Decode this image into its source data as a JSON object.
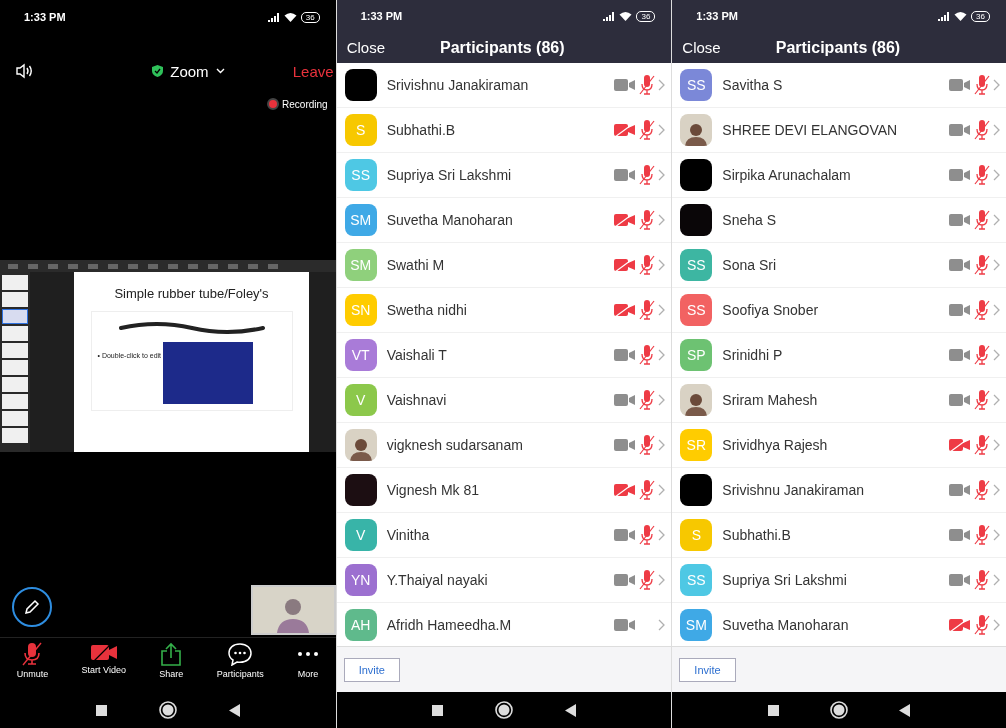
{
  "screens": [
    {
      "kind": "meeting",
      "status": {
        "time": "1:33 PM",
        "battery": "36"
      },
      "meeting_title": "Zoom",
      "leave": "Leave",
      "recording": "Recording",
      "slide": {
        "title": "Simple rubber tube/Foley's",
        "bullet": "• Double-click to edit",
        "thumbnails": [
          {
            "selected": false
          },
          {
            "selected": false
          },
          {
            "selected": true
          },
          {
            "selected": false
          },
          {
            "selected": false
          },
          {
            "selected": false
          },
          {
            "selected": false
          },
          {
            "selected": false
          },
          {
            "selected": false
          },
          {
            "selected": false
          }
        ]
      },
      "toolbar": [
        {
          "kind": "mic",
          "label": "Unmute"
        },
        {
          "kind": "video",
          "label": "Start Video"
        },
        {
          "kind": "share",
          "label": "Share"
        },
        {
          "kind": "chat",
          "label": "Participants"
        },
        {
          "kind": "more",
          "label": "More"
        }
      ]
    },
    {
      "kind": "participants",
      "status": {
        "time": "1:33 PM",
        "battery": "36"
      },
      "close": "Close",
      "title": "Participants (86)",
      "invite": "Invite",
      "participants": [
        {
          "name": "Srivishnu Janakiraman",
          "kind": "blank",
          "color": "#000000",
          "video_off": false,
          "muted": true
        },
        {
          "name": "Subhathi.B",
          "kind": "initials",
          "initials": "S",
          "color": "#f7c800",
          "video_off": true,
          "muted": true
        },
        {
          "name": "Supriya Sri Lakshmi",
          "kind": "initials",
          "initials": "SS",
          "color": "#4ec8e4",
          "video_off": false,
          "muted": true
        },
        {
          "name": "Suvetha Manoharan",
          "kind": "initials",
          "initials": "SM",
          "color": "#3fa9e6",
          "video_off": true,
          "muted": true
        },
        {
          "name": "Swathi M",
          "kind": "initials",
          "initials": "SM",
          "color": "#8fd07c",
          "video_off": true,
          "muted": true
        },
        {
          "name": "Swetha nidhi",
          "kind": "initials",
          "initials": "SN",
          "color": "#ffcc00",
          "video_off": true,
          "muted": true
        },
        {
          "name": "Vaishali T",
          "kind": "initials",
          "initials": "VT",
          "color": "#a97bd8",
          "video_off": false,
          "muted": true
        },
        {
          "name": "Vaishnavi",
          "kind": "initials",
          "initials": "V",
          "color": "#8cc84b",
          "video_off": false,
          "muted": true
        },
        {
          "name": "vigknesh sudarsanam",
          "kind": "photo",
          "video_off": false,
          "muted": true
        },
        {
          "name": "Vignesh Mk 81",
          "kind": "blank",
          "color": "#1c0e12",
          "video_off": true,
          "muted": true
        },
        {
          "name": "Vinitha",
          "kind": "initials",
          "initials": "V",
          "color": "#38b4a8",
          "video_off": false,
          "muted": true
        },
        {
          "name": "Y.Thaiyal nayaki",
          "kind": "initials",
          "initials": "YN",
          "color": "#9c70d0",
          "video_off": false,
          "muted": true
        },
        {
          "name": "Afridh Hameedha.M",
          "kind": "initials",
          "initials": "AH",
          "color": "#5fba8c",
          "video_off": false,
          "muted": false
        }
      ]
    },
    {
      "kind": "participants",
      "status": {
        "time": "1:33 PM",
        "battery": "36"
      },
      "close": "Close",
      "title": "Participants (86)",
      "invite": "Invite",
      "participants": [
        {
          "name": "Savitha S",
          "kind": "initials",
          "initials": "SS",
          "color": "#7b88d8",
          "video_off": false,
          "muted": true
        },
        {
          "name": "SHREE DEVI ELANGOVAN",
          "kind": "photo",
          "video_off": false,
          "muted": true
        },
        {
          "name": "Sirpika Arunachalam",
          "kind": "blank",
          "color": "#000000",
          "video_off": false,
          "muted": true
        },
        {
          "name": "Sneha S",
          "kind": "blank",
          "color": "#0a0608",
          "video_off": false,
          "muted": true
        },
        {
          "name": "Sona Sri",
          "kind": "initials",
          "initials": "SS",
          "color": "#3db6a2",
          "video_off": false,
          "muted": true
        },
        {
          "name": "Soofiya Snober",
          "kind": "initials",
          "initials": "SS",
          "color": "#f26262",
          "video_off": false,
          "muted": true
        },
        {
          "name": "Srinidhi P",
          "kind": "initials",
          "initials": "SP",
          "color": "#6dc272",
          "video_off": false,
          "muted": true
        },
        {
          "name": "Sriram Mahesh",
          "kind": "photo",
          "video_off": false,
          "muted": true
        },
        {
          "name": "Srividhya Rajesh",
          "kind": "initials",
          "initials": "SR",
          "color": "#ffcc00",
          "video_off": true,
          "muted": true
        },
        {
          "name": "Srivishnu Janakiraman",
          "kind": "blank",
          "color": "#000000",
          "video_off": false,
          "muted": true
        },
        {
          "name": "Subhathi.B",
          "kind": "initials",
          "initials": "S",
          "color": "#f7c800",
          "video_off": false,
          "muted": true
        },
        {
          "name": "Supriya Sri Lakshmi",
          "kind": "initials",
          "initials": "SS",
          "color": "#4ec8e4",
          "video_off": false,
          "muted": true
        },
        {
          "name": "Suvetha Manoharan",
          "kind": "initials",
          "initials": "SM",
          "color": "#3fa9e6",
          "video_off": true,
          "muted": true
        }
      ]
    }
  ]
}
